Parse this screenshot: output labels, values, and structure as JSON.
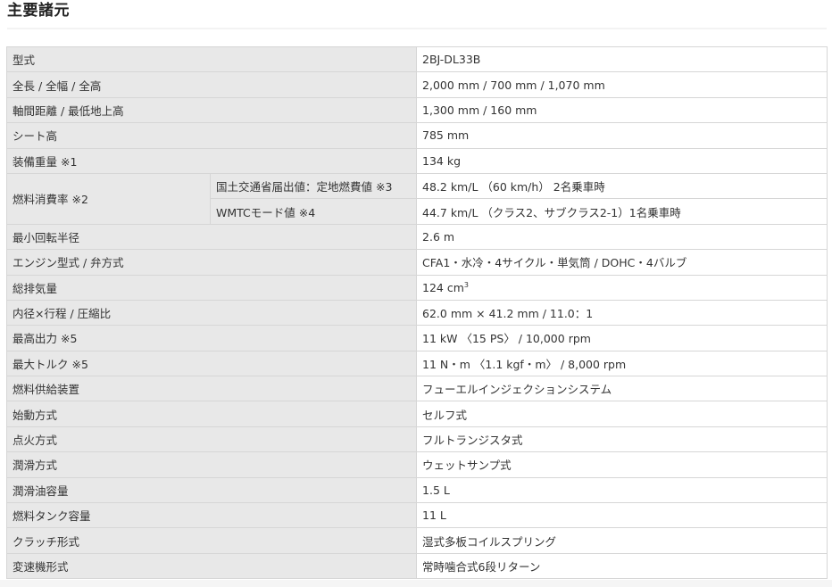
{
  "title": "主要諸元",
  "rows": [
    {
      "label": "型式",
      "value": "2BJ-DL33B"
    },
    {
      "label": "全長 / 全幅 / 全高",
      "value": "2,000 mm / 700 mm / 1,070 mm"
    },
    {
      "label": "軸間距離 / 最低地上高",
      "value": "1,300 mm / 160 mm"
    },
    {
      "label": "シート高",
      "value": "785 mm"
    },
    {
      "label": "装備重量 ※1",
      "value": "134 kg"
    },
    {
      "label": "燃料消費率 ※2",
      "sub": [
        {
          "label": "国土交通省届出値：定地燃費値 ※3",
          "value": "48.2 km/L （60 km/h） 2名乗車時"
        },
        {
          "label": "WMTCモード値 ※4",
          "value": "44.7 km/L （クラス2、サブクラス2-1）1名乗車時"
        }
      ]
    },
    {
      "label": "最小回転半径",
      "value": "2.6 m"
    },
    {
      "label": "エンジン型式 / 弁方式",
      "value": "CFA1・水冷・4サイクル・単気筒 / DOHC・4バルブ"
    },
    {
      "label": "総排気量",
      "value": "124 cm",
      "value_sup": "3"
    },
    {
      "label": "内径×行程 / 圧縮比",
      "value": "62.0 mm × 41.2 mm / 11.0：1"
    },
    {
      "label": "最高出力 ※5",
      "value": "11 kW 〈15 PS〉 / 10,000 rpm"
    },
    {
      "label": "最大トルク ※5",
      "value": "11 N・m 〈1.1 kgf・m〉 / 8,000 rpm"
    },
    {
      "label": "燃料供給装置",
      "value": "フューエルインジェクションシステム"
    },
    {
      "label": "始動方式",
      "value": "セルフ式"
    },
    {
      "label": "点火方式",
      "value": "フルトランジスタ式"
    },
    {
      "label": "潤滑方式",
      "value": "ウェットサンプ式"
    },
    {
      "label": "潤滑油容量",
      "value": "1.5 L"
    },
    {
      "label": "燃料タンク容量",
      "value": "11 L"
    },
    {
      "label": "クラッチ形式",
      "value": "湿式多板コイルスプリング"
    },
    {
      "label": "変速機形式",
      "value": "常時噛合式6段リターン"
    }
  ],
  "colors": {
    "label_bg": "#e8e8e8",
    "border": "#d6d6d6",
    "text": "#333333"
  }
}
